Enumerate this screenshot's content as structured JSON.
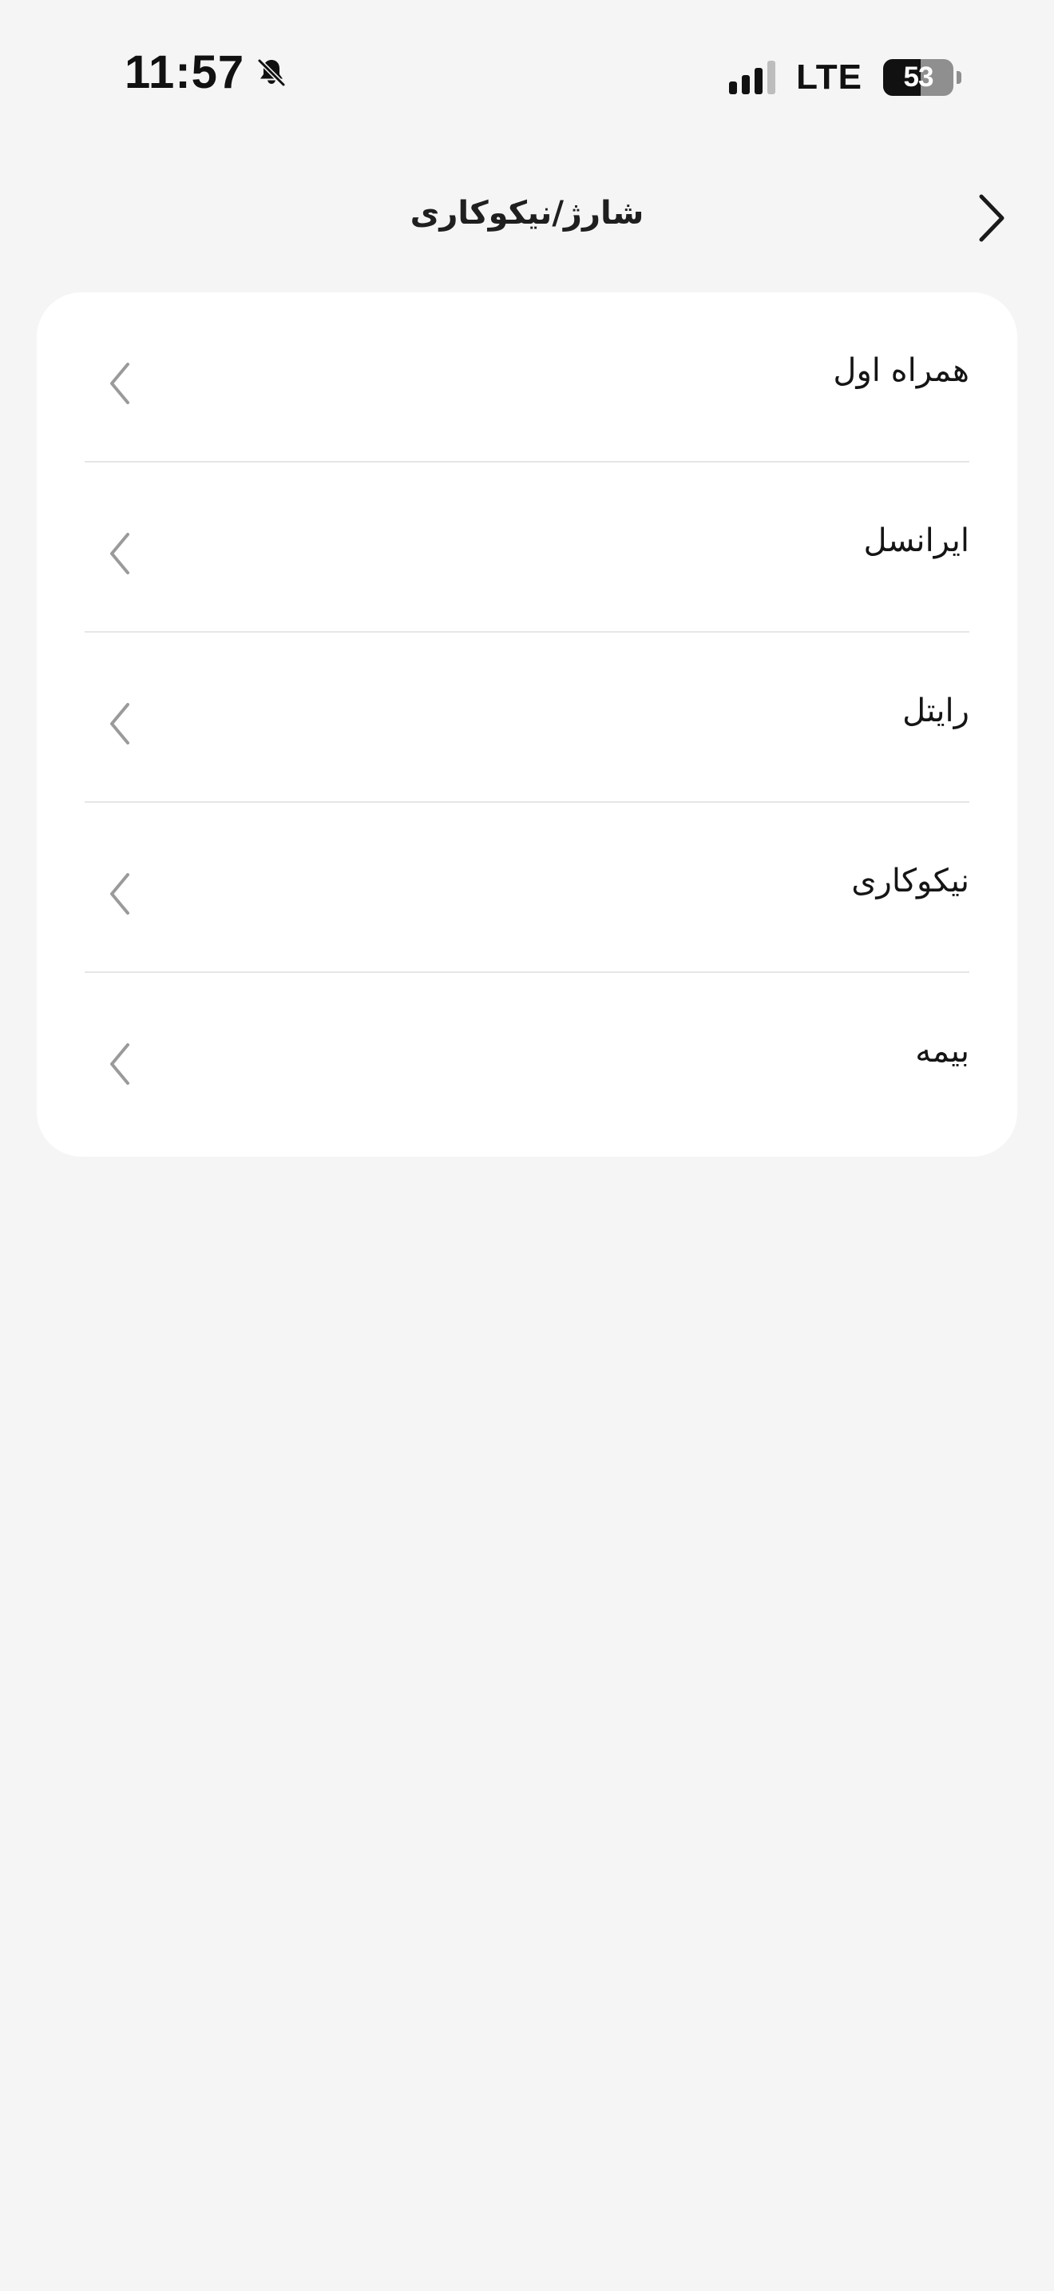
{
  "status_bar": {
    "time": "11:57",
    "notification_icon": "bell-slash-icon",
    "signal_icon": "signal-icon",
    "network": "LTE",
    "battery_level": "53",
    "battery_percent": 53
  },
  "header": {
    "title": "شارژ/نیکوکاری",
    "back_icon": "chevron-right-icon"
  },
  "list": {
    "items": [
      {
        "label": "همراه اول",
        "icon": "chevron-left-icon"
      },
      {
        "label": "ایرانسل",
        "icon": "chevron-left-icon"
      },
      {
        "label": "رایتل",
        "icon": "chevron-left-icon"
      },
      {
        "label": "نیکوکاری",
        "icon": "chevron-left-icon"
      },
      {
        "label": "بیمه",
        "icon": "chevron-left-icon"
      }
    ]
  },
  "colors": {
    "background": "#f5f5f5",
    "card": "#ffffff",
    "divider": "#e6e6e6",
    "chevron": "#9a9a9a",
    "text": "#151515"
  }
}
